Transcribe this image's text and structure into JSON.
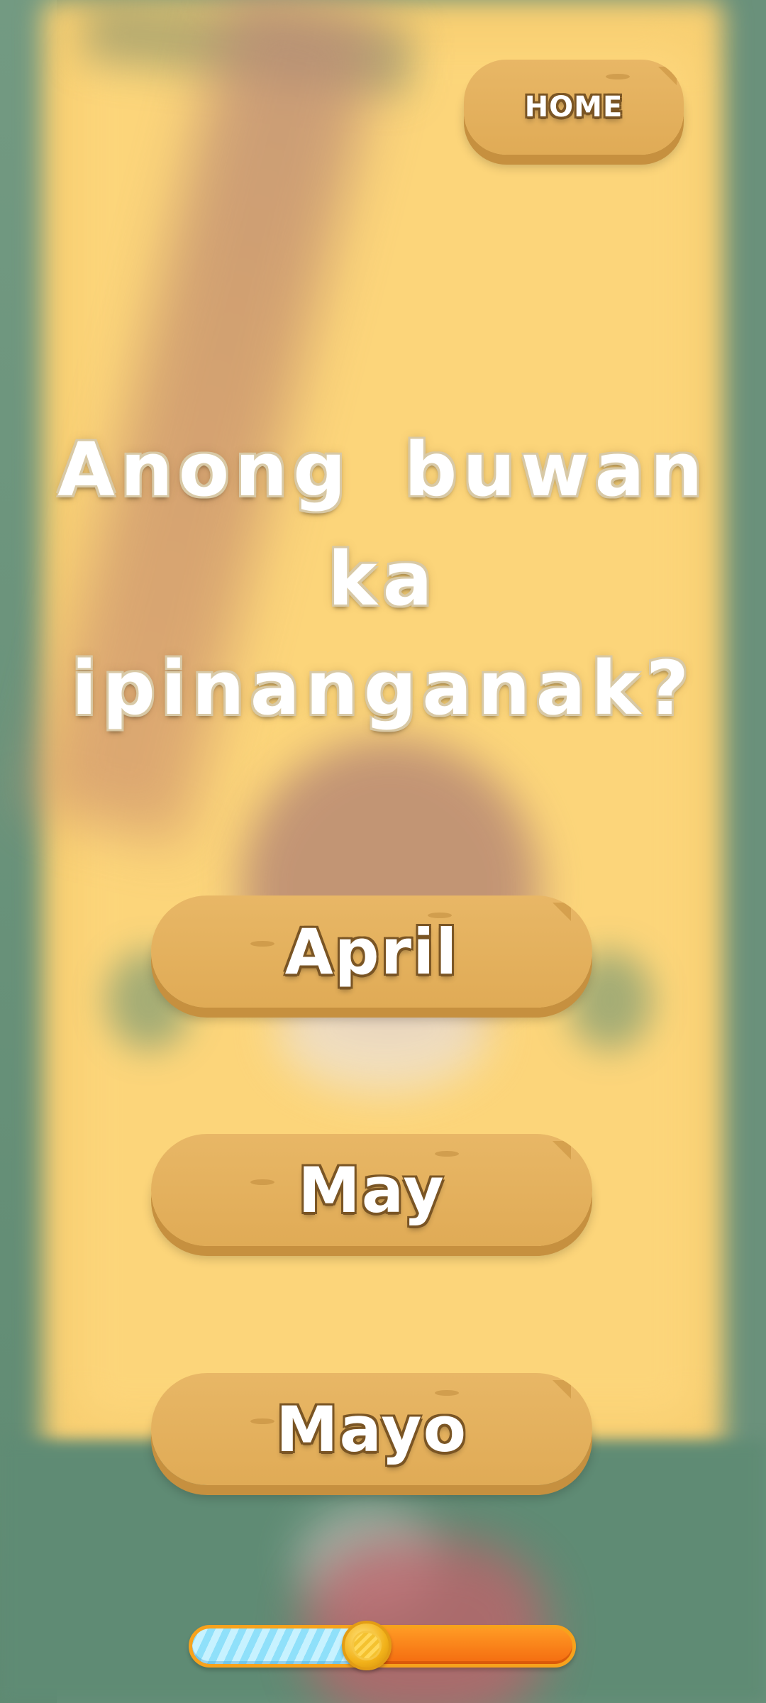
{
  "header": {
    "home_label": "HOME"
  },
  "question": {
    "text": "Anong buwan ka ipinanganak?"
  },
  "answers": [
    {
      "label": "April"
    },
    {
      "label": "May"
    },
    {
      "label": "Mayo"
    }
  ],
  "progress": {
    "fraction": 0.46,
    "icon": "coin-icon"
  },
  "colors": {
    "button_wood": "#e3b05c",
    "button_shadow": "#c6903f",
    "progress_filled": "#8fe0fa",
    "progress_empty": "#f46b10",
    "text": "#ffffff"
  }
}
